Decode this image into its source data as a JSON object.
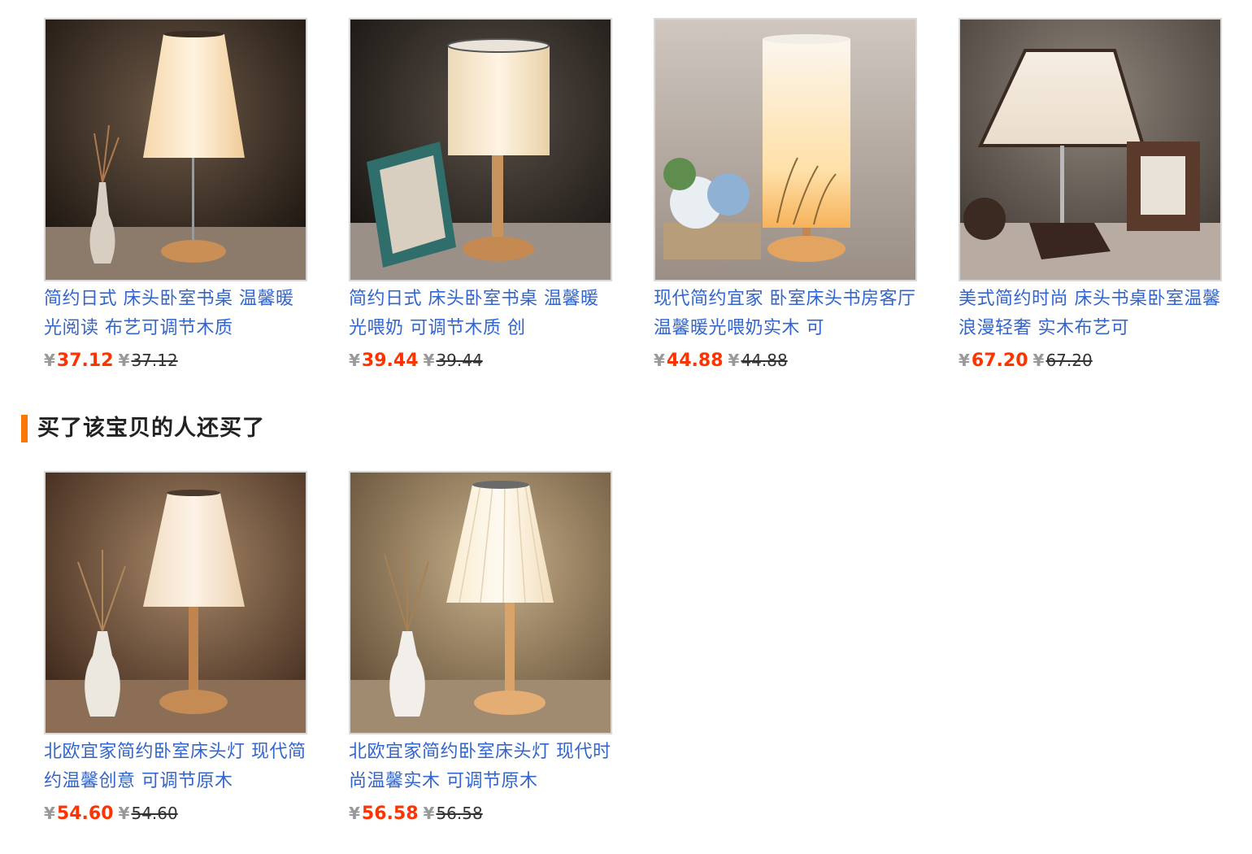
{
  "products": [
    {
      "title": "简约日式 床头卧室书桌 温馨暖光阅读 布艺可调节木质",
      "currency": "¥",
      "price": "37.12",
      "original_price": "37.12"
    },
    {
      "title": "简约日式 床头卧室书桌 温馨暖光喂奶 可调节木质 创",
      "currency": "¥",
      "price": "39.44",
      "original_price": "39.44"
    },
    {
      "title": "现代简约宜家 卧室床头书房客厅 温馨暖光喂奶实木 可",
      "currency": "¥",
      "price": "44.88",
      "original_price": "44.88"
    },
    {
      "title": "美式简约时尚 床头书桌卧室温馨浪漫轻奢 实木布艺可",
      "currency": "¥",
      "price": "67.20",
      "original_price": "67.20"
    }
  ],
  "also_bought": {
    "heading": "买了该宝贝的人还买了",
    "items": [
      {
        "title": "北欧宜家简约卧室床头灯 现代简约温馨创意 可调节原木",
        "currency": "¥",
        "price": "54.60",
        "original_price": "54.60"
      },
      {
        "title": "北欧宜家简约卧室床头灯 现代时尚温馨实木 可调节原木",
        "currency": "¥",
        "price": "56.58",
        "original_price": "56.58"
      }
    ]
  },
  "colors": {
    "link": "#3366cc",
    "price": "#ff3300",
    "accent": "#ff7700"
  }
}
